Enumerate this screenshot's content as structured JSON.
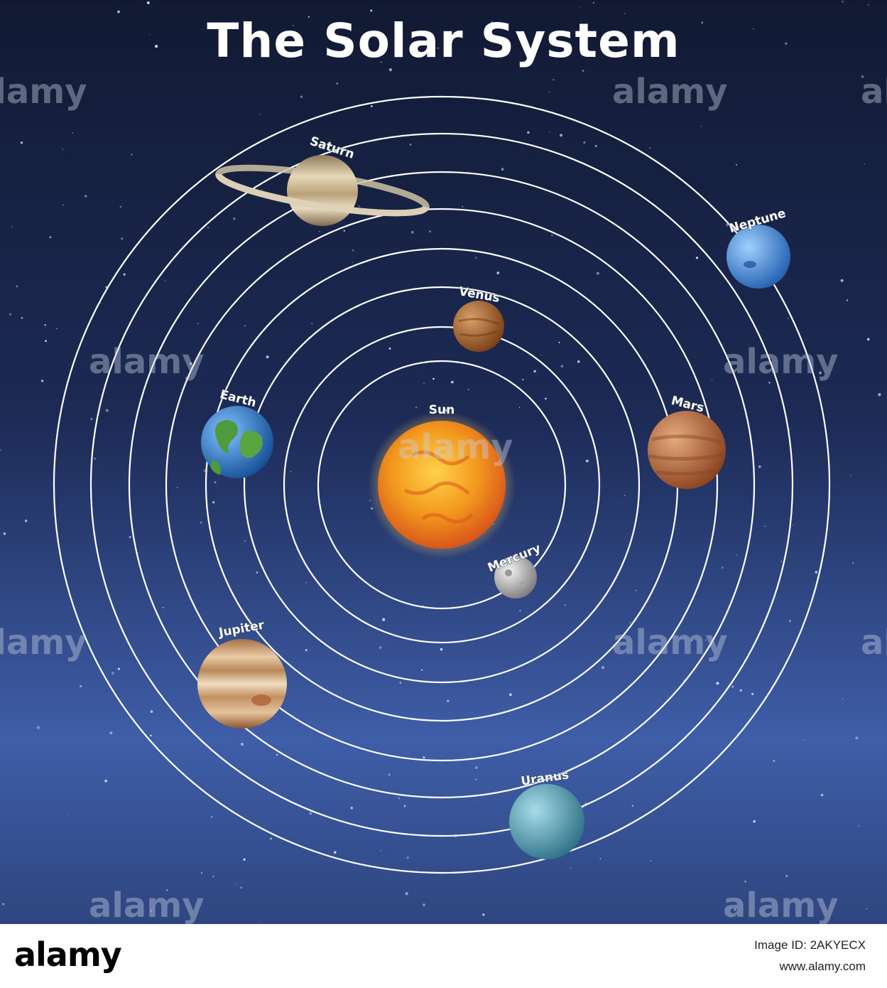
{
  "title": "The Solar System",
  "colors": {
    "background_top": "#131a33",
    "background_bottom": "#4a6fb8",
    "orbit": "#ffffff",
    "label": "#ffffff"
  },
  "center_body": {
    "label": "Sun",
    "icon": "sun-icon"
  },
  "planets": [
    {
      "label": "Mercury",
      "icon": "mercury-icon",
      "color": "#c8c8c8"
    },
    {
      "label": "Venus",
      "icon": "venus-icon",
      "color": "#a8622c"
    },
    {
      "label": "Earth",
      "icon": "earth-icon",
      "color": "#3a7cc7"
    },
    {
      "label": "Mars",
      "icon": "mars-icon",
      "color": "#b0643a"
    },
    {
      "label": "Jupiter",
      "icon": "jupiter-icon",
      "color": "#b98a5c"
    },
    {
      "label": "Saturn",
      "icon": "saturn-icon",
      "color": "#c9b58e"
    },
    {
      "label": "Uranus",
      "icon": "uranus-icon",
      "color": "#5fa3b8"
    },
    {
      "label": "Neptune",
      "icon": "neptune-icon",
      "color": "#4a90d9"
    }
  ],
  "watermark": "alamy",
  "footer": {
    "logo": "alamy",
    "image_id": "Image ID: 2AKYECX",
    "url": "www.alamy.com"
  }
}
